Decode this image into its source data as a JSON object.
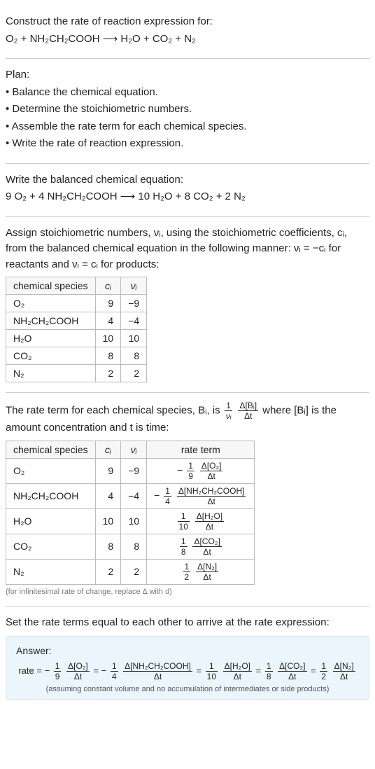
{
  "intro": {
    "title": "Construct the rate of reaction expression for:",
    "equation": "O₂ + NH₂CH₂COOH ⟶ H₂O + CO₂ + N₂"
  },
  "plan": {
    "heading": "Plan:",
    "items": [
      "Balance the chemical equation.",
      "Determine the stoichiometric numbers.",
      "Assemble the rate term for each chemical species.",
      "Write the rate of reaction expression."
    ]
  },
  "balanced": {
    "heading": "Write the balanced chemical equation:",
    "equation": "9 O₂ + 4 NH₂CH₂COOH ⟶ 10 H₂O + 8 CO₂ + 2 N₂"
  },
  "stoich": {
    "text": "Assign stoichiometric numbers, νᵢ, using the stoichiometric coefficients, cᵢ, from the balanced chemical equation in the following manner: νᵢ = −cᵢ for reactants and νᵢ = cᵢ for products:",
    "headers": [
      "chemical species",
      "cᵢ",
      "νᵢ"
    ],
    "rows": [
      {
        "species": "O₂",
        "c": "9",
        "v": "−9"
      },
      {
        "species": "NH₂CH₂COOH",
        "c": "4",
        "v": "−4"
      },
      {
        "species": "H₂O",
        "c": "10",
        "v": "10"
      },
      {
        "species": "CO₂",
        "c": "8",
        "v": "8"
      },
      {
        "species": "N₂",
        "c": "2",
        "v": "2"
      }
    ]
  },
  "rateterm": {
    "text_prefix": "The rate term for each chemical species, Bᵢ, is ",
    "text_suffix": " where [Bᵢ] is the amount concentration and t is time:",
    "headers": [
      "chemical species",
      "cᵢ",
      "νᵢ",
      "rate term"
    ],
    "rows": [
      {
        "species": "O₂",
        "c": "9",
        "v": "−9",
        "sign": "−",
        "coef_num": "1",
        "coef_den": "9",
        "d_num": "Δ[O₂]",
        "d_den": "Δt"
      },
      {
        "species": "NH₂CH₂COOH",
        "c": "4",
        "v": "−4",
        "sign": "−",
        "coef_num": "1",
        "coef_den": "4",
        "d_num": "Δ[NH₂CH₂COOH]",
        "d_den": "Δt"
      },
      {
        "species": "H₂O",
        "c": "10",
        "v": "10",
        "sign": "",
        "coef_num": "1",
        "coef_den": "10",
        "d_num": "Δ[H₂O]",
        "d_den": "Δt"
      },
      {
        "species": "CO₂",
        "c": "8",
        "v": "8",
        "sign": "",
        "coef_num": "1",
        "coef_den": "8",
        "d_num": "Δ[CO₂]",
        "d_den": "Δt"
      },
      {
        "species": "N₂",
        "c": "2",
        "v": "2",
        "sign": "",
        "coef_num": "1",
        "coef_den": "2",
        "d_num": "Δ[N₂]",
        "d_den": "Δt"
      }
    ],
    "note": "(for infinitesimal rate of change, replace Δ with d)"
  },
  "final": {
    "heading": "Set the rate terms equal to each other to arrive at the rate expression:",
    "answer_label": "Answer:",
    "rate_label": "rate",
    "terms": [
      {
        "sign": "−",
        "coef_num": "1",
        "coef_den": "9",
        "d_num": "Δ[O₂]",
        "d_den": "Δt"
      },
      {
        "sign": "−",
        "coef_num": "1",
        "coef_den": "4",
        "d_num": "Δ[NH₂CH₂COOH]",
        "d_den": "Δt"
      },
      {
        "sign": "",
        "coef_num": "1",
        "coef_den": "10",
        "d_num": "Δ[H₂O]",
        "d_den": "Δt"
      },
      {
        "sign": "",
        "coef_num": "1",
        "coef_den": "8",
        "d_num": "Δ[CO₂]",
        "d_den": "Δt"
      },
      {
        "sign": "",
        "coef_num": "1",
        "coef_den": "2",
        "d_num": "Δ[N₂]",
        "d_den": "Δt"
      }
    ],
    "note": "(assuming constant volume and no accumulation of intermediates or side products)"
  },
  "generic_frac": {
    "one": "1",
    "vi": "νᵢ",
    "dBi": "Δ[Bᵢ]",
    "dt": "Δt"
  }
}
